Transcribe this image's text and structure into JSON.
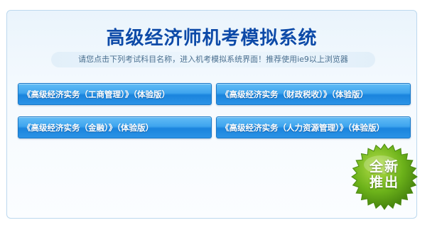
{
  "header": {
    "title": "高级经济师机考模拟系统",
    "subtitle": "请您点击下列考试科目名称，进入机考模拟系统界面！推荐使用ie9以上浏览器"
  },
  "exams": [
    {
      "label": "《高级经济实务（工商管理）》（体验版）"
    },
    {
      "label": "《高级经济实务（财政税收）》（体验版）"
    },
    {
      "label": "《高级经济实务（金融）》（体验版）"
    },
    {
      "label": "《高级经济实务（人力资源管理）》（体验版）"
    }
  ],
  "badge": {
    "line1": "全新",
    "line2": "推出"
  },
  "colors": {
    "title": "#0d4aa8",
    "button": "#2b93e6",
    "badge": "#6cb21a"
  }
}
